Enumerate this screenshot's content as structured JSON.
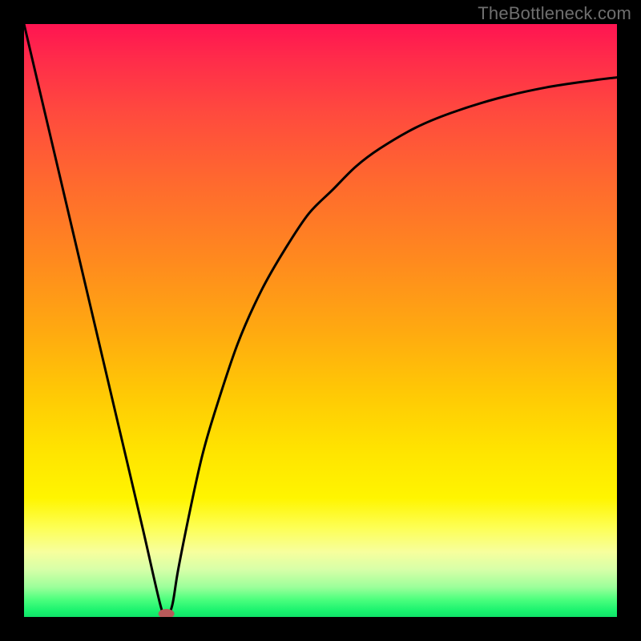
{
  "watermark": "TheBottleneck.com",
  "colors": {
    "background": "#000000",
    "curve": "#000000",
    "marker": "#b85a5a",
    "watermark_text": "#6f6f6f"
  },
  "chart_data": {
    "type": "line",
    "title": "",
    "xlabel": "",
    "ylabel": "",
    "xlim": [
      0,
      100
    ],
    "ylim": [
      0,
      100
    ],
    "grid": false,
    "x": [
      0,
      4,
      8,
      12,
      16,
      20,
      23,
      24,
      25,
      26,
      28,
      30,
      32,
      36,
      40,
      44,
      48,
      52,
      56,
      60,
      66,
      72,
      80,
      88,
      96,
      100
    ],
    "values": [
      100,
      83,
      66,
      49,
      32,
      15,
      2,
      0,
      2,
      8,
      18,
      27,
      34,
      46,
      55,
      62,
      68,
      72,
      76,
      79,
      82.5,
      85,
      87.5,
      89.3,
      90.5,
      91
    ],
    "series": [
      {
        "name": "bottleneck-curve",
        "x": [
          0,
          4,
          8,
          12,
          16,
          20,
          23,
          24,
          25,
          26,
          28,
          30,
          32,
          36,
          40,
          44,
          48,
          52,
          56,
          60,
          66,
          72,
          80,
          88,
          96,
          100
        ],
        "values": [
          100,
          83,
          66,
          49,
          32,
          15,
          2,
          0,
          2,
          8,
          18,
          27,
          34,
          46,
          55,
          62,
          68,
          72,
          76,
          79,
          82.5,
          85,
          87.5,
          89.3,
          90.5,
          91
        ]
      }
    ],
    "marker": {
      "x": 24,
      "y": 0
    },
    "legend": false
  }
}
